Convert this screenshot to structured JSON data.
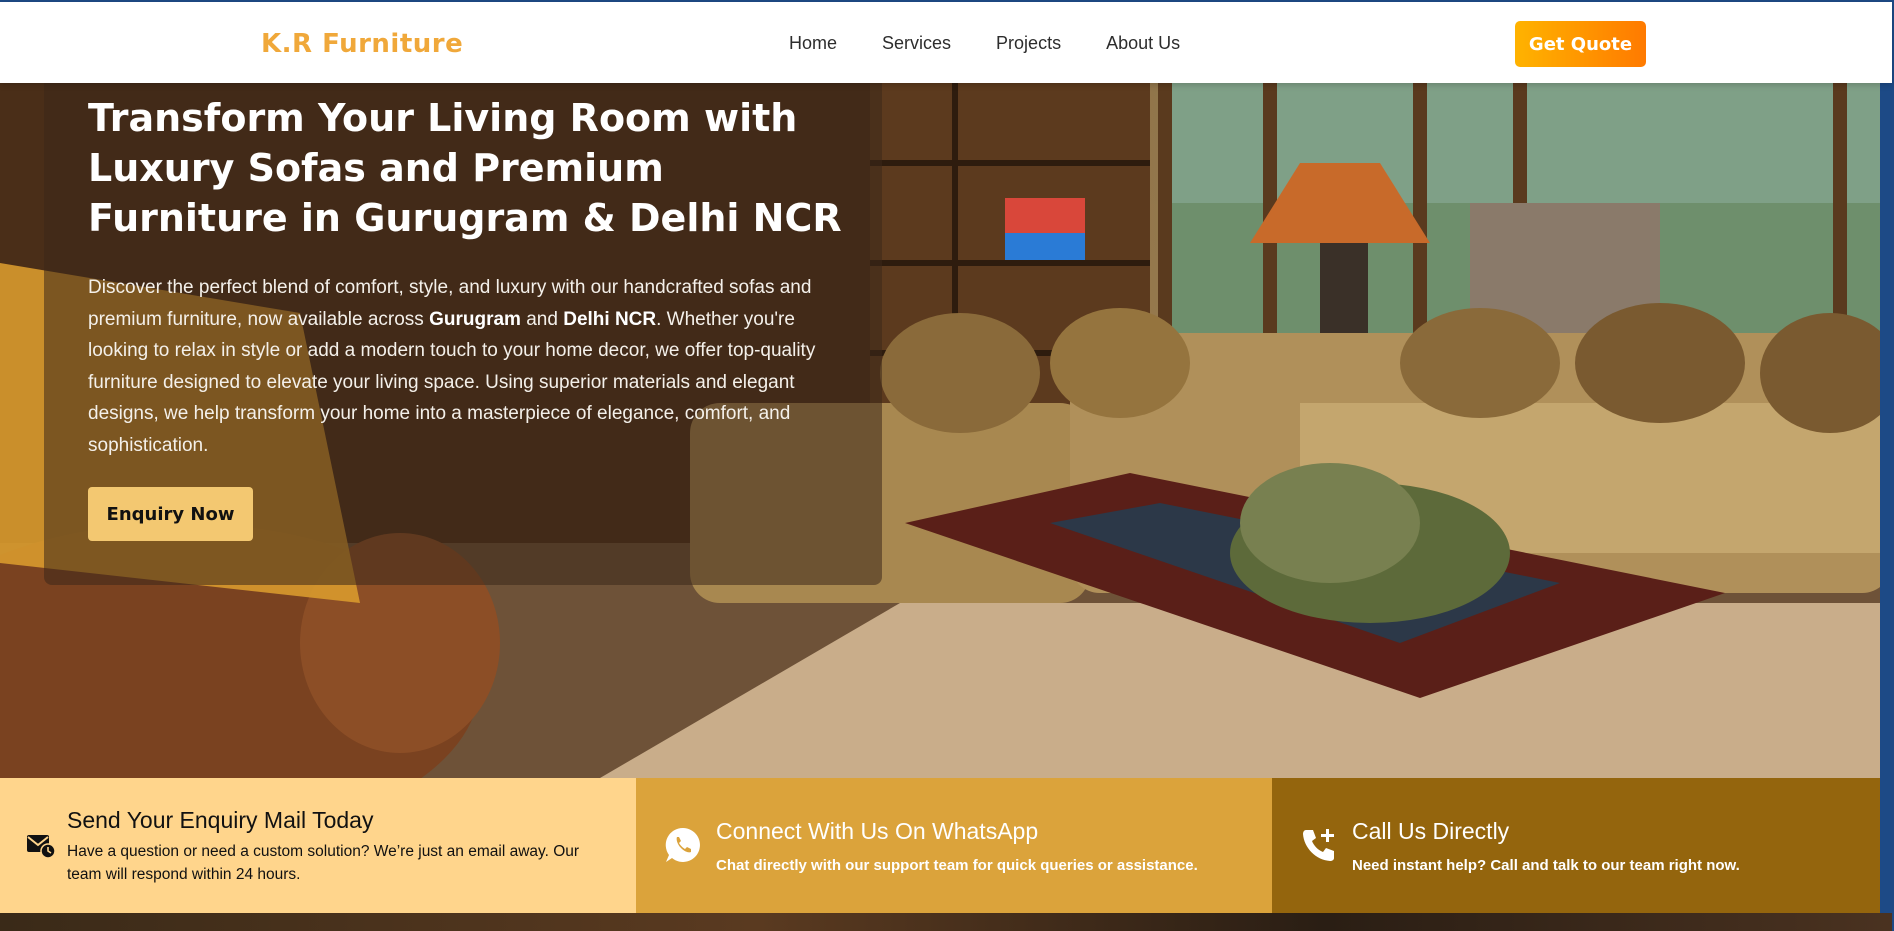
{
  "header": {
    "logo": "K.R Furniture",
    "nav": [
      "Home",
      "Services",
      "Projects",
      "About Us"
    ],
    "cta": "Get Quote"
  },
  "hero": {
    "title": "Transform Your Living Room with Luxury Sofas and Premium Furniture in Gurugram & Delhi NCR",
    "text_part1": "Discover the perfect blend of comfort, style, and luxury with our handcrafted sofas and premium furniture, now available across ",
    "bold1": "Gurugram",
    "text_part2": " and ",
    "bold2": "Delhi NCR",
    "text_part3": ". Whether you're looking to relax in style or add a modern touch to your home decor, we offer top-quality furniture designed to elevate your living space. Using superior materials and elegant designs, we help transform your home into a masterpiece of elegance, comfort, and sophistication.",
    "button": "Enquiry Now"
  },
  "contact": {
    "mail": {
      "icon": "mail-clock-icon",
      "title": "Send Your Enquiry Mail Today",
      "text": "Have a question or need a custom solution? We’re just an email away. Our team will respond within 24 hours."
    },
    "whatsapp": {
      "icon": "whatsapp-icon",
      "title": "Connect With Us On WhatsApp",
      "text": "Chat directly with our support team for quick queries or assistance."
    },
    "call": {
      "icon": "phone-plus-icon",
      "title": "Call Us Directly",
      "text": "Need instant help? Call and talk to our team right now."
    }
  },
  "colors": {
    "logo": "#f0a83a",
    "cta_gradient_start": "#ffb300",
    "cta_gradient_end": "#ff7a00",
    "enquiry_button": "#f3c871",
    "mail_card": "#ffd58c",
    "whatsapp_card": "#dba33b",
    "call_card": "#94650d"
  }
}
